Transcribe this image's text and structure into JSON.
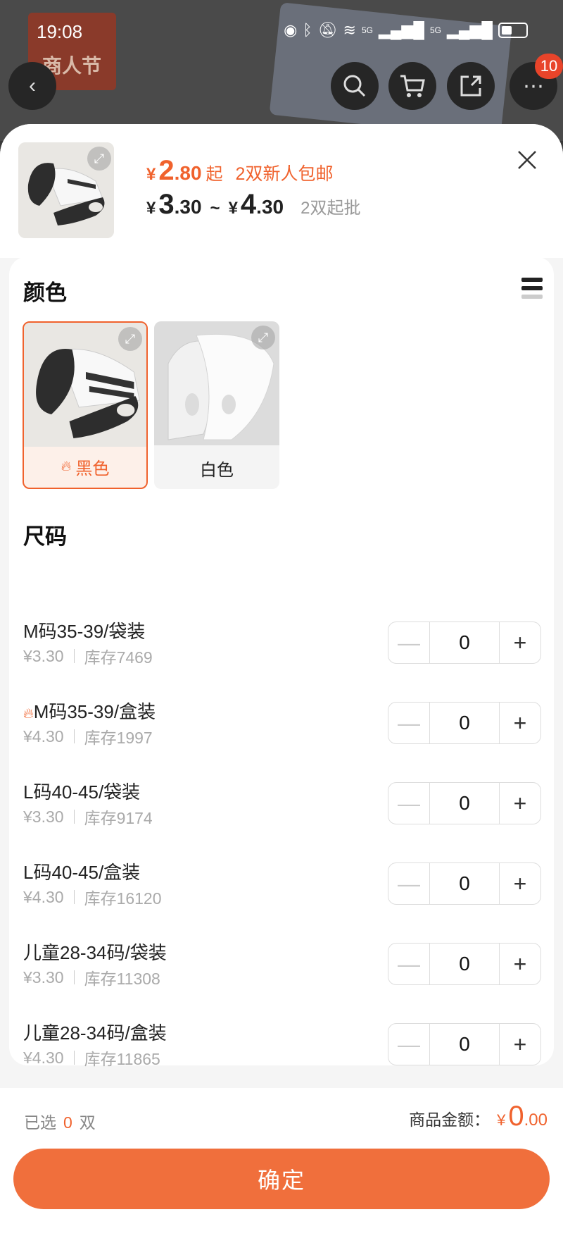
{
  "status_bar": {
    "time": "19:08",
    "network1": "5G",
    "network2": "5G"
  },
  "background": {
    "banner_text": "商人节",
    "cart_badge": "10"
  },
  "header": {
    "promo_currency": "¥",
    "promo_price_int": "2",
    "promo_price_dec": ".80",
    "promo_suffix": "起",
    "promo_note": "2双新人包邮",
    "range_currency_1": "¥",
    "range_low_int": "3",
    "range_low_dec": ".30",
    "range_sep": "~",
    "range_currency_2": "¥",
    "range_high_int": "4",
    "range_high_dec": ".30",
    "min_order": "2双起批"
  },
  "colors": {
    "title": "颜色",
    "options": [
      {
        "label": "黑色",
        "selected": true,
        "hot": true
      },
      {
        "label": "白色",
        "selected": false,
        "hot": false
      }
    ]
  },
  "sizes": {
    "title": "尺码",
    "items": [
      {
        "name": "M码35-39/袋装",
        "price": "¥3.30",
        "stock": "库存7469",
        "qty": "0",
        "hot": false
      },
      {
        "name": "M码35-39/盒装",
        "price": "¥4.30",
        "stock": "库存1997",
        "qty": "0",
        "hot": true
      },
      {
        "name": "L码40-45/袋装",
        "price": "¥3.30",
        "stock": "库存9174",
        "qty": "0",
        "hot": false
      },
      {
        "name": "L码40-45/盒装",
        "price": "¥4.30",
        "stock": "库存16120",
        "qty": "0",
        "hot": false
      },
      {
        "name": "儿童28-34码/袋装",
        "price": "¥3.30",
        "stock": "库存11308",
        "qty": "0",
        "hot": false
      },
      {
        "name": "儿童28-34码/盒装",
        "price": "¥4.30",
        "stock": "库存11865",
        "qty": "0",
        "hot": false
      }
    ]
  },
  "footer": {
    "selected_prefix": "已选",
    "selected_count": "0",
    "selected_unit": "双",
    "amount_label": "商品金额：",
    "amount_currency": "¥",
    "amount_int": "0",
    "amount_dec": ".00",
    "confirm_label": "确定"
  },
  "theme": {
    "accent": "#f0622d",
    "button": "#f06f3c"
  }
}
